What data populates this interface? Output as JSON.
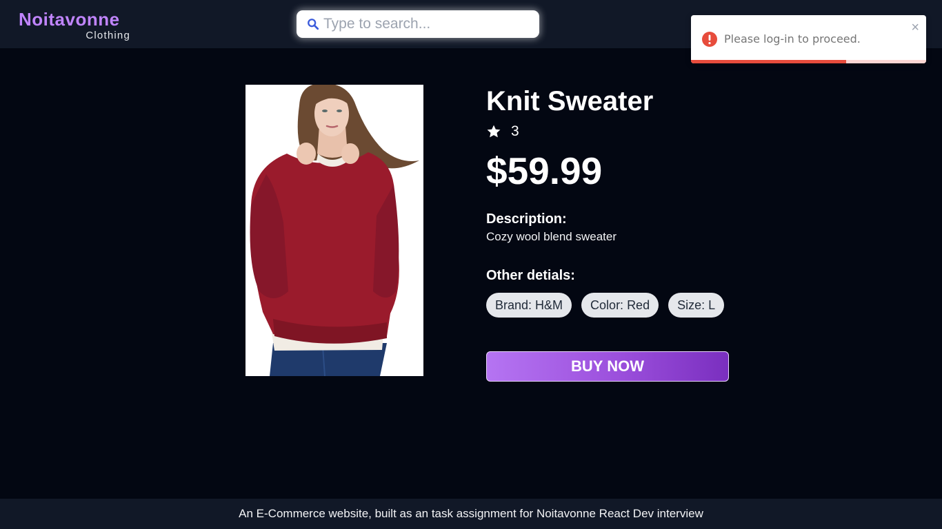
{
  "header": {
    "brand_name": "Noitavonne",
    "brand_sub": "Clothing",
    "search": {
      "placeholder": "Type to search...",
      "value": ""
    }
  },
  "toast": {
    "message": "Please log-in to proceed.",
    "close_glyph": "×",
    "progress_fraction": 0.66,
    "icon": "error-icon"
  },
  "product": {
    "image_alt": "Knit Sweater",
    "title": "Knit Sweater",
    "rating": "3",
    "price": "$59.99",
    "description_label": "Description:",
    "description": "Cozy wool blend sweater",
    "other_details_label": "Other detials:",
    "details": {
      "brand": "Brand: H&M",
      "color": "Color: Red",
      "size": "Size: L"
    },
    "buy_label": "BUY NOW"
  },
  "footer": {
    "text": "An E-Commerce website, built as an task assignment for Noitavonne React Dev interview"
  },
  "colors": {
    "background": "#030712",
    "header": "#111827",
    "brand": "#c084fc",
    "button": "#9b4fdc",
    "toast_error": "#e74c3c"
  }
}
